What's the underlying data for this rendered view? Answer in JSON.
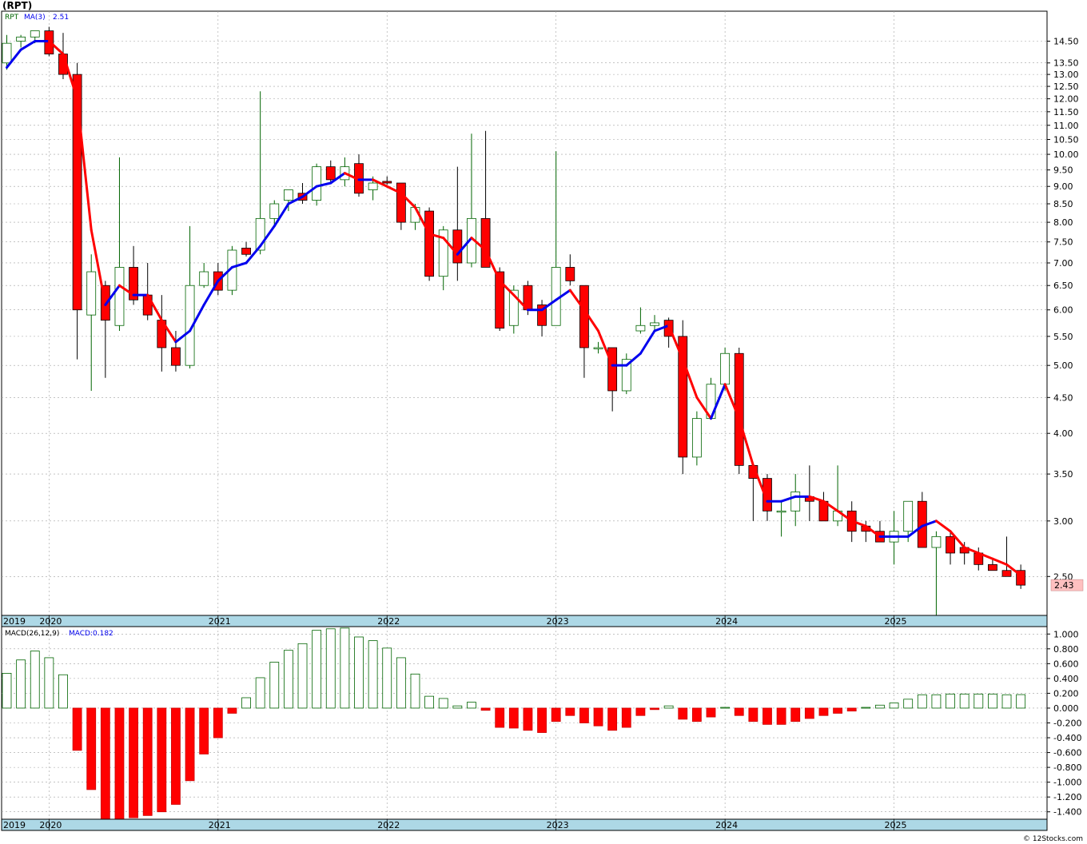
{
  "title": "(RPT)",
  "footer": "© 12Stocks.com",
  "price_panel": {
    "symbol_label": "RPT",
    "ma_label": "MA(3)",
    "ma_value": "2.51",
    "last_price": "2.43"
  },
  "macd_panel": {
    "label": "MACD(26,12,9)",
    "value_label": "MACD:0.182"
  },
  "colors": {
    "up_candle_fill": "#ffffff",
    "up_candle_edge": "#006400",
    "down_candle": "#ff0000",
    "ma_up": "#0000ee",
    "ma_down": "#ff0000",
    "grid": "#a0a0a0",
    "axis_band": "#add8e6",
    "last_price_box": "#ffc0c0"
  },
  "chart_data": [
    {
      "type": "candlestick",
      "title": "(RPT)",
      "frequency": "monthly",
      "y_scale": "log",
      "ylim": [
        2.2,
        16.0
      ],
      "y_ticks": [
        "2.50",
        "3.00",
        "3.50",
        "4.00",
        "4.50",
        "5.00",
        "5.50",
        "6.00",
        "6.50",
        "7.00",
        "7.50",
        "8.00",
        "8.50",
        "9.00",
        "9.50",
        "10.00",
        "10.50",
        "11.00",
        "11.50",
        "12.00",
        "12.50",
        "13.00",
        "13.50",
        "14.50"
      ],
      "x_start": "2019-10",
      "x_labels": [
        "2019",
        "2020",
        "2021",
        "2022",
        "2023",
        "2024",
        "2025"
      ],
      "series": [
        {
          "o": 13.5,
          "h": 14.8,
          "l": 13.2,
          "c": 14.4
        },
        {
          "o": 14.5,
          "h": 14.8,
          "l": 14.2,
          "c": 14.7
        },
        {
          "o": 14.7,
          "h": 15.0,
          "l": 14.4,
          "c": 15.0
        },
        {
          "o": 15.0,
          "h": 15.2,
          "l": 13.8,
          "c": 13.9
        },
        {
          "o": 13.9,
          "h": 14.9,
          "l": 12.8,
          "c": 13.0
        },
        {
          "o": 13.0,
          "h": 13.5,
          "l": 5.1,
          "c": 6.0
        },
        {
          "o": 5.9,
          "h": 7.2,
          "l": 4.6,
          "c": 6.8
        },
        {
          "o": 6.5,
          "h": 6.6,
          "l": 4.8,
          "c": 5.8
        },
        {
          "o": 5.7,
          "h": 9.9,
          "l": 5.6,
          "c": 6.9
        },
        {
          "o": 6.9,
          "h": 7.4,
          "l": 6.1,
          "c": 6.2
        },
        {
          "o": 6.3,
          "h": 7.0,
          "l": 5.8,
          "c": 5.9
        },
        {
          "o": 5.8,
          "h": 6.3,
          "l": 4.9,
          "c": 5.3
        },
        {
          "o": 5.3,
          "h": 5.6,
          "l": 4.9,
          "c": 5.0
        },
        {
          "o": 5.0,
          "h": 7.9,
          "l": 4.95,
          "c": 6.5
        },
        {
          "o": 6.5,
          "h": 7.0,
          "l": 6.45,
          "c": 6.8
        },
        {
          "o": 6.8,
          "h": 7.0,
          "l": 6.3,
          "c": 6.4
        },
        {
          "o": 6.4,
          "h": 7.4,
          "l": 6.3,
          "c": 7.3
        },
        {
          "o": 7.35,
          "h": 7.5,
          "l": 7.15,
          "c": 7.2
        },
        {
          "o": 7.3,
          "h": 12.3,
          "l": 7.2,
          "c": 8.1
        },
        {
          "o": 8.1,
          "h": 8.6,
          "l": 7.9,
          "c": 8.5
        },
        {
          "o": 8.6,
          "h": 8.9,
          "l": 8.3,
          "c": 8.9
        },
        {
          "o": 8.8,
          "h": 9.1,
          "l": 8.5,
          "c": 8.6
        },
        {
          "o": 8.6,
          "h": 9.7,
          "l": 8.45,
          "c": 9.6
        },
        {
          "o": 9.6,
          "h": 9.8,
          "l": 9.1,
          "c": 9.2
        },
        {
          "o": 9.2,
          "h": 9.9,
          "l": 9.0,
          "c": 9.6
        },
        {
          "o": 9.7,
          "h": 10.0,
          "l": 8.7,
          "c": 8.8
        },
        {
          "o": 8.9,
          "h": 9.3,
          "l": 8.6,
          "c": 9.1
        },
        {
          "o": 9.15,
          "h": 9.3,
          "l": 9.05,
          "c": 9.1
        },
        {
          "o": 9.1,
          "h": 9.1,
          "l": 7.8,
          "c": 8.0
        },
        {
          "o": 8.0,
          "h": 8.5,
          "l": 7.8,
          "c": 8.4
        },
        {
          "o": 8.3,
          "h": 8.4,
          "l": 6.6,
          "c": 6.7
        },
        {
          "o": 6.7,
          "h": 7.9,
          "l": 6.4,
          "c": 7.8
        },
        {
          "o": 7.8,
          "h": 9.6,
          "l": 6.6,
          "c": 7.0
        },
        {
          "o": 7.0,
          "h": 10.7,
          "l": 6.9,
          "c": 8.1
        },
        {
          "o": 8.1,
          "h": 10.8,
          "l": 6.9,
          "c": 6.9
        },
        {
          "o": 6.8,
          "h": 6.9,
          "l": 5.6,
          "c": 5.65
        },
        {
          "o": 5.7,
          "h": 6.5,
          "l": 5.55,
          "c": 6.4
        },
        {
          "o": 6.5,
          "h": 6.6,
          "l": 5.9,
          "c": 6.0
        },
        {
          "o": 6.1,
          "h": 6.2,
          "l": 5.5,
          "c": 5.7
        },
        {
          "o": 5.7,
          "h": 10.1,
          "l": 5.7,
          "c": 6.9
        },
        {
          "o": 6.9,
          "h": 7.2,
          "l": 6.5,
          "c": 6.6
        },
        {
          "o": 6.5,
          "h": 6.5,
          "l": 4.8,
          "c": 5.3
        },
        {
          "o": 5.3,
          "h": 5.4,
          "l": 5.2,
          "c": 5.3
        },
        {
          "o": 5.3,
          "h": 5.3,
          "l": 4.3,
          "c": 4.6
        },
        {
          "o": 4.6,
          "h": 5.2,
          "l": 4.55,
          "c": 5.1
        },
        {
          "o": 5.6,
          "h": 6.05,
          "l": 5.55,
          "c": 5.7
        },
        {
          "o": 5.7,
          "h": 5.9,
          "l": 5.6,
          "c": 5.75
        },
        {
          "o": 5.8,
          "h": 5.85,
          "l": 5.3,
          "c": 5.5
        },
        {
          "o": 5.5,
          "h": 5.8,
          "l": 3.5,
          "c": 3.7
        },
        {
          "o": 3.7,
          "h": 4.3,
          "l": 3.6,
          "c": 4.2
        },
        {
          "o": 4.2,
          "h": 4.8,
          "l": 4.2,
          "c": 4.7
        },
        {
          "o": 4.7,
          "h": 5.3,
          "l": 4.6,
          "c": 5.2
        },
        {
          "o": 5.2,
          "h": 5.3,
          "l": 3.5,
          "c": 3.6
        },
        {
          "o": 3.6,
          "h": 3.6,
          "l": 3.0,
          "c": 3.45
        },
        {
          "o": 3.45,
          "h": 3.5,
          "l": 3.0,
          "c": 3.1
        },
        {
          "o": 3.1,
          "h": 3.2,
          "l": 2.85,
          "c": 3.1
        },
        {
          "o": 3.1,
          "h": 3.5,
          "l": 2.95,
          "c": 3.3
        },
        {
          "o": 3.25,
          "h": 3.6,
          "l": 3.0,
          "c": 3.2
        },
        {
          "o": 3.2,
          "h": 3.3,
          "l": 3.0,
          "c": 3.0
        },
        {
          "o": 3.0,
          "h": 3.6,
          "l": 2.95,
          "c": 3.1
        },
        {
          "o": 3.1,
          "h": 3.2,
          "l": 2.8,
          "c": 2.9
        },
        {
          "o": 2.95,
          "h": 3.0,
          "l": 2.8,
          "c": 2.9
        },
        {
          "o": 2.9,
          "h": 3.0,
          "l": 2.8,
          "c": 2.8
        },
        {
          "o": 2.8,
          "h": 3.1,
          "l": 2.6,
          "c": 2.9
        },
        {
          "o": 2.9,
          "h": 3.2,
          "l": 2.8,
          "c": 3.2
        },
        {
          "o": 3.2,
          "h": 3.3,
          "l": 2.8,
          "c": 2.75
        },
        {
          "o": 2.75,
          "h": 2.9,
          "l": 2.2,
          "c": 2.85
        },
        {
          "o": 2.85,
          "h": 2.9,
          "l": 2.6,
          "c": 2.7
        },
        {
          "o": 2.75,
          "h": 2.8,
          "l": 2.6,
          "c": 2.7
        },
        {
          "o": 2.7,
          "h": 2.75,
          "l": 2.55,
          "c": 2.6
        },
        {
          "o": 2.6,
          "h": 2.65,
          "l": 2.55,
          "c": 2.55
        },
        {
          "o": 2.55,
          "h": 2.85,
          "l": 2.5,
          "c": 2.5
        },
        {
          "o": 2.55,
          "h": 2.6,
          "l": 2.4,
          "c": 2.43
        }
      ],
      "ma": [
        13.3,
        14.1,
        14.5,
        14.5,
        13.9,
        12.0,
        7.8,
        6.1,
        6.5,
        6.3,
        6.3,
        5.8,
        5.4,
        5.6,
        6.1,
        6.6,
        6.9,
        7.0,
        7.4,
        7.9,
        8.5,
        8.7,
        9.0,
        9.1,
        9.4,
        9.2,
        9.2,
        9.0,
        8.8,
        8.4,
        7.7,
        7.6,
        7.2,
        7.6,
        7.3,
        6.6,
        6.3,
        6.0,
        6.0,
        6.2,
        6.4,
        6.0,
        5.6,
        5.0,
        5.0,
        5.2,
        5.6,
        5.7,
        5.1,
        4.5,
        4.2,
        4.7,
        4.2,
        3.6,
        3.2,
        3.2,
        3.25,
        3.25,
        3.2,
        3.1,
        3.0,
        2.95,
        2.85,
        2.85,
        2.85,
        2.95,
        3.0,
        2.9,
        2.75,
        2.7,
        2.65,
        2.6,
        2.51
      ]
    },
    {
      "type": "bar",
      "title": "MACD(26,12,9)",
      "ylim": [
        -1.5,
        1.1
      ],
      "y_ticks": [
        "1.000",
        "0.800",
        "0.600",
        "0.400",
        "0.200",
        "0.000",
        "-0.200",
        "-0.400",
        "-0.600",
        "-0.800",
        "-1.000",
        "-1.200",
        "-1.400"
      ],
      "values": [
        0.47,
        0.65,
        0.77,
        0.68,
        0.45,
        -0.57,
        -1.1,
        -1.52,
        -1.52,
        -1.48,
        -1.45,
        -1.4,
        -1.3,
        -0.98,
        -0.62,
        -0.4,
        -0.07,
        0.14,
        0.41,
        0.62,
        0.78,
        0.87,
        1.05,
        1.07,
        1.08,
        0.96,
        0.91,
        0.81,
        0.68,
        0.46,
        0.16,
        0.13,
        0.03,
        0.08,
        -0.03,
        -0.26,
        -0.27,
        -0.3,
        -0.33,
        -0.18,
        -0.1,
        -0.2,
        -0.24,
        -0.3,
        -0.26,
        -0.1,
        -0.02,
        0.03,
        -0.15,
        -0.18,
        -0.12,
        0.01,
        -0.1,
        -0.18,
        -0.22,
        -0.22,
        -0.18,
        -0.14,
        -0.1,
        -0.07,
        -0.04,
        0.01,
        0.04,
        0.07,
        0.12,
        0.18,
        0.18,
        0.19,
        0.19,
        0.19,
        0.19,
        0.18,
        0.182
      ]
    }
  ]
}
